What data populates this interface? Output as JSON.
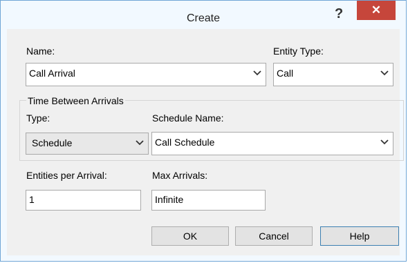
{
  "window": {
    "title": "Create",
    "help_glyph": "?",
    "close_glyph": "✕"
  },
  "name": {
    "label": "Name:",
    "value": "Call Arrival"
  },
  "entity_type": {
    "label": "Entity Type:",
    "value": "Call"
  },
  "time_between": {
    "group_label": "Time Between Arrivals",
    "type_label": "Type:",
    "type_value": "Schedule",
    "schedule_label": "Schedule Name:",
    "schedule_value": "Call Schedule"
  },
  "entities_per_arrival": {
    "label": "Entities per Arrival:",
    "value": "1"
  },
  "max_arrivals": {
    "label": "Max Arrivals:",
    "value": "Infinite"
  },
  "buttons": {
    "ok": "OK",
    "cancel": "Cancel",
    "help": "Help"
  },
  "icons": {
    "dropdown": "chevron-down-icon",
    "help": "help-icon",
    "close": "close-icon"
  },
  "colors": {
    "close_button": "#c6463b",
    "frame": "#f2f9ff",
    "border": "#6fa6d6"
  }
}
